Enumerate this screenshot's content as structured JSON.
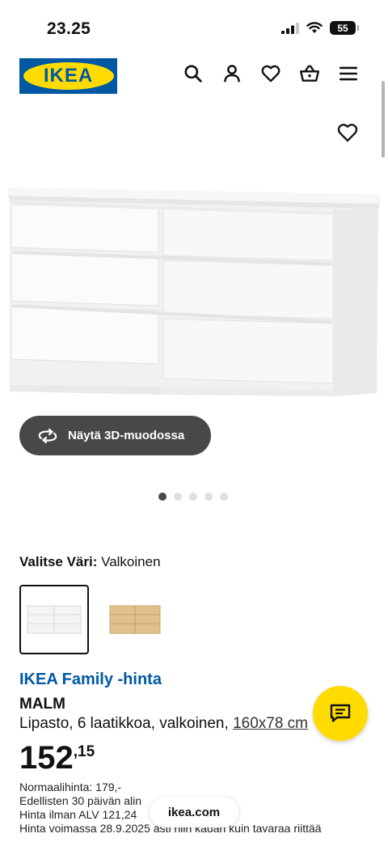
{
  "status_bar": {
    "time": "23.25",
    "battery": "55"
  },
  "header": {
    "logo_text": "IKEA"
  },
  "gallery": {
    "view_3d_label": "Näytä 3D-muodossa",
    "dot_count": 5,
    "active_dot": 1
  },
  "color_select": {
    "label": "Valitse Väri:",
    "selected": "Valkoinen",
    "options": [
      "white",
      "oak-veneer"
    ]
  },
  "product": {
    "family_price_label": "IKEA Family -hinta",
    "name": "MALM",
    "description": "Lipasto, 6 laatikkoa, valkoinen,",
    "measure": "160x78 cm",
    "price_int": "152",
    "price_dec": ",15",
    "notes": {
      "normal_label": "Normaalihinta:",
      "normal_value": "179,-",
      "last30": "Edellisten 30 päivän alin",
      "ex_vat": "Hinta ilman ALV 121,24",
      "validity": "Hinta voimassa 28.9.2025 asti niin kauan kuin tavaraa riittää"
    }
  },
  "browser": {
    "url": "ikea.com"
  },
  "colors": {
    "ikea_blue": "#0058a3",
    "ikea_yellow": "#ffdb00",
    "button_dark": "#484848"
  }
}
